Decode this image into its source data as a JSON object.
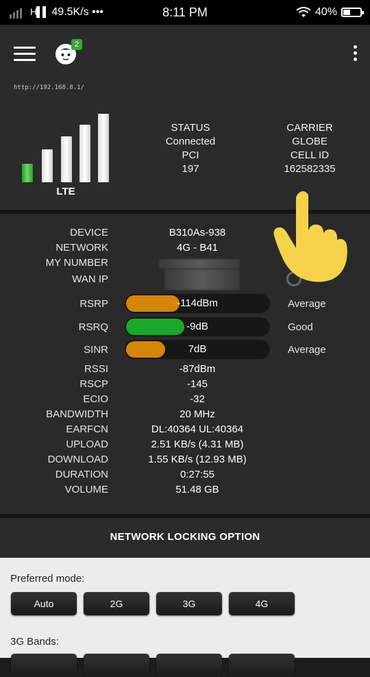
{
  "status_bar": {
    "network_speed": "49.5K/s",
    "dots": "•••",
    "time": "8:11 PM",
    "battery_percent": "40%",
    "battery_level": 0.4
  },
  "app_bar": {
    "notification_count": "2",
    "router_url": "http://192.168.8.1/"
  },
  "signal": {
    "technology": "LTE",
    "bars_total": 5,
    "bars_active": 1
  },
  "summary": {
    "left": [
      {
        "label": "STATUS",
        "value": "Connected"
      },
      {
        "label": "PCI",
        "value": "197"
      }
    ],
    "right": [
      {
        "label": "CARRIER",
        "value": "GLOBE"
      },
      {
        "label": "CELL ID",
        "value": "162582335"
      }
    ]
  },
  "details": {
    "device": {
      "label": "DEVICE",
      "value": "B310As-938"
    },
    "network": {
      "label": "NETWORK",
      "value": "4G - B41"
    },
    "my_number": {
      "label": "MY NUMBER"
    },
    "wan_ip": {
      "label": "WAN IP"
    },
    "rsrp": {
      "label": "RSRP",
      "value": "-114dBm",
      "level": 0.37,
      "color": "#d4860b",
      "rating": "Average"
    },
    "rsrq": {
      "label": "RSRQ",
      "value": "-9dB",
      "level": 0.4,
      "color": "#1ba82a",
      "rating": "Good"
    },
    "sinr": {
      "label": "SINR",
      "value": "7dB",
      "level": 0.27,
      "color": "#d4860b",
      "rating": "Average"
    },
    "rssi": {
      "label": "RSSI",
      "value": "-87dBm"
    },
    "rscp": {
      "label": "RSCP",
      "value": "-145"
    },
    "ecio": {
      "label": "ECIO",
      "value": "-32"
    },
    "bandwidth": {
      "label": "BANDWIDTH",
      "value": "20 MHz"
    },
    "earfcn": {
      "label": "EARFCN",
      "value": "DL:40364 UL:40364"
    },
    "upload": {
      "label": "UPLOAD",
      "value": "2.51 KB/s (4.31 MB)"
    },
    "download": {
      "label": "DOWNLOAD",
      "value": "1.55 KB/s (12.93 MB)"
    },
    "duration": {
      "label": "DURATION",
      "value": "0:27:55"
    },
    "volume": {
      "label": "VOLUME",
      "value": "51.48 GB"
    }
  },
  "network_locking": {
    "button_label": "NETWORK LOCKING OPTION",
    "preferred_mode_label": "Preferred mode:",
    "modes": [
      "Auto",
      "2G",
      "3G",
      "4G"
    ],
    "bands_3g_label": "3G Bands:"
  },
  "colors": {
    "accent_green": "#1ba82a",
    "accent_orange": "#d4860b",
    "hand_yellow": "#f6d24a"
  }
}
